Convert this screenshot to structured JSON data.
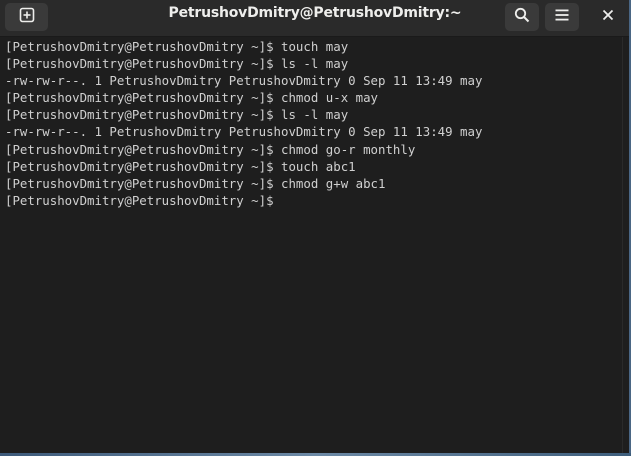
{
  "window": {
    "title": "PetrushovDmitry@PetrushovDmitry:~"
  },
  "icons": {
    "new_tab": "new-tab-icon",
    "search": "search-icon",
    "menu": "hamburger-menu-icon",
    "close": "close-icon"
  },
  "terminal": {
    "lines": [
      "[PetrushovDmitry@PetrushovDmitry ~]$ touch may",
      "[PetrushovDmitry@PetrushovDmitry ~]$ ls -l may",
      "-rw-rw-r--. 1 PetrushovDmitry PetrushovDmitry 0 Sep 11 13:49 may",
      "[PetrushovDmitry@PetrushovDmitry ~]$ chmod u-x may",
      "[PetrushovDmitry@PetrushovDmitry ~]$ ls -l may",
      "-rw-rw-r--. 1 PetrushovDmitry PetrushovDmitry 0 Sep 11 13:49 may",
      "[PetrushovDmitry@PetrushovDmitry ~]$ chmod go-r monthly",
      "[PetrushovDmitry@PetrushovDmitry ~]$ touch abc1",
      "[PetrushovDmitry@PetrushovDmitry ~]$ chmod g+w abc1",
      "[PetrushovDmitry@PetrushovDmitry ~]$ "
    ]
  },
  "colors": {
    "background": "#1e1e1e",
    "text": "#d0d0d0",
    "titlebar": "#2a2a2a"
  }
}
